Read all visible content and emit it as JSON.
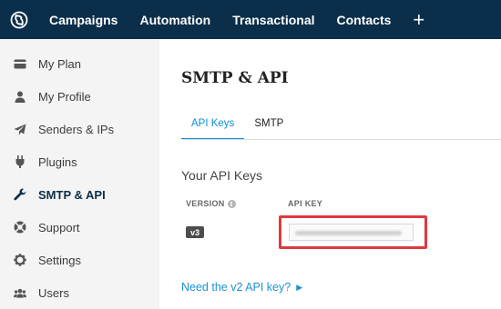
{
  "topnav": {
    "items": [
      "Campaigns",
      "Automation",
      "Transactional",
      "Contacts"
    ],
    "add_label": "+"
  },
  "sidebar": {
    "items": [
      {
        "label": "My Plan",
        "icon": "card-icon"
      },
      {
        "label": "My Profile",
        "icon": "user-icon"
      },
      {
        "label": "Senders & IPs",
        "icon": "paper-plane-icon"
      },
      {
        "label": "Plugins",
        "icon": "plug-icon"
      },
      {
        "label": "SMTP & API",
        "icon": "wrench-icon"
      },
      {
        "label": "Support",
        "icon": "lifebuoy-icon"
      },
      {
        "label": "Settings",
        "icon": "gear-icon"
      },
      {
        "label": "Users",
        "icon": "users-icon"
      }
    ],
    "active": "SMTP & API"
  },
  "main": {
    "title": "SMTP & API",
    "tabs": [
      {
        "label": "API Keys",
        "active": true
      },
      {
        "label": "SMTP",
        "active": false
      }
    ],
    "section_title": "Your API Keys",
    "columns": {
      "version": "VERSION",
      "api_key": "API KEY"
    },
    "rows": [
      {
        "version": "v3",
        "api_key_masked": true
      }
    ],
    "v2_link": "Need the v2 API key?"
  },
  "colors": {
    "topbar": "#0b2e4a",
    "accent": "#0a8fd8",
    "highlight": "#e0393e",
    "sidebar_bg": "#f4f4f4"
  }
}
